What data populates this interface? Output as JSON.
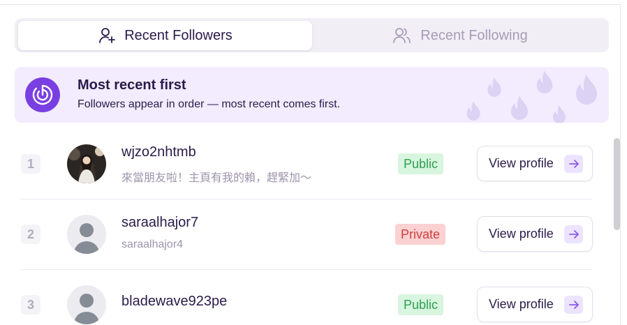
{
  "tabs": [
    {
      "label": "Recent Followers",
      "active": true,
      "icon": "user-plus-icon"
    },
    {
      "label": "Recent Following",
      "active": false,
      "icon": "users-icon"
    }
  ],
  "banner": {
    "title": "Most recent first",
    "subtitle": "Followers appear in order — most recent comes first.",
    "icon": "clock-radar-icon",
    "decoration": "flame-icons"
  },
  "followers": [
    {
      "rank": "1",
      "username": "wjzo2nhtmb",
      "subline": "來當朋友啦！主頁有我的賴，趕緊加～",
      "visibility": "Public",
      "avatar": "photo",
      "button": "View profile"
    },
    {
      "rank": "2",
      "username": "saraalhajor7",
      "subline": "saraalhajor4",
      "visibility": "Private",
      "avatar": "placeholder",
      "button": "View profile"
    },
    {
      "rank": "3",
      "username": "bladewave923pe",
      "subline": "",
      "visibility": "Public",
      "avatar": "placeholder",
      "button": "View profile"
    }
  ],
  "colors": {
    "accent": "#7a3fe2",
    "public_bg": "#d8f5df",
    "public_text": "#2f9e51",
    "private_bg": "#fbd1d1",
    "private_text": "#cf3f3f"
  }
}
